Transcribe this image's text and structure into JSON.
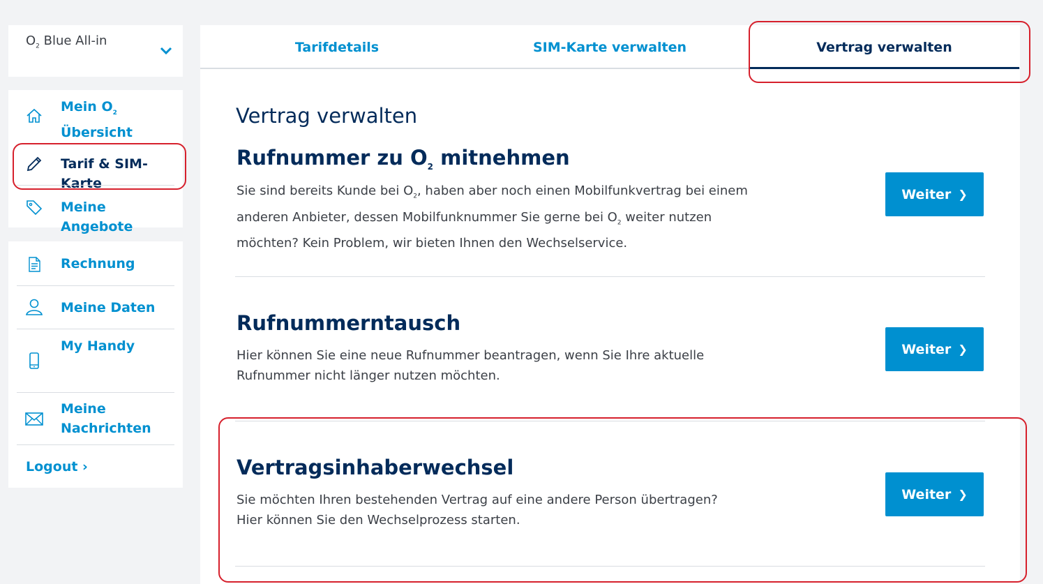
{
  "tariff": {
    "prefix": "O",
    "prefix_sub": "2",
    "name": " Blue All-in"
  },
  "nav": {
    "primary": [
      {
        "label_line1": "Mein O",
        "label_sub": "2",
        "label_line2": "Übersicht",
        "icon": "home-icon"
      },
      {
        "label": "Tarif & SIM-Karte",
        "icon": "pencil-icon",
        "active": true
      },
      {
        "label": "Meine Angebote",
        "icon": "tag-icon"
      }
    ],
    "secondary": [
      {
        "label": "Rechnung",
        "icon": "document-icon"
      },
      {
        "label": "Meine Daten",
        "icon": "user-icon"
      },
      {
        "label": "My Handy",
        "icon": "phone-icon"
      },
      {
        "label_line1": "Meine",
        "label_line2": "Nachrichten",
        "icon": "envelope-icon"
      }
    ],
    "logout": "Logout ›"
  },
  "tabs": [
    {
      "label": "Tarifdetails"
    },
    {
      "label": "SIM-Karte verwalten"
    },
    {
      "label": "Vertrag verwalten",
      "active": true
    }
  ],
  "main": {
    "heading": "Vertrag verwalten",
    "sections": [
      {
        "title_pre": "Rufnummer zu O",
        "title_sub": "2",
        "title_post": " mitnehmen",
        "text_1": "Sie sind bereits Kunde bei O",
        "text_sub_1": "2",
        "text_2": ", haben aber noch einen Mobilfunkvertrag bei einem anderen Anbieter, dessen Mobilfunknummer Sie gerne bei O",
        "text_sub_2": "2",
        "text_3": " weiter nutzen möchten? Kein Problem, wir bieten Ihnen den Wechselservice.",
        "button": "Weiter"
      },
      {
        "title": "Rufnummerntausch",
        "text": "Hier können Sie eine neue Rufnummer beantragen, wenn Sie Ihre aktuelle Rufnummer nicht länger nutzen möchten.",
        "button": "Weiter"
      },
      {
        "title": "Vertragsinhaberwechsel",
        "text": "Sie möchten Ihren bestehenden Vertrag auf eine andere Person übertragen? Hier können Sie den Wechselprozess starten.",
        "button": "Weiter"
      }
    ]
  },
  "colors": {
    "accent": "#0090d0",
    "navy": "#032b5a",
    "text": "#3b3f46",
    "background": "#f2f3f5",
    "annotation": "#d6202c"
  }
}
